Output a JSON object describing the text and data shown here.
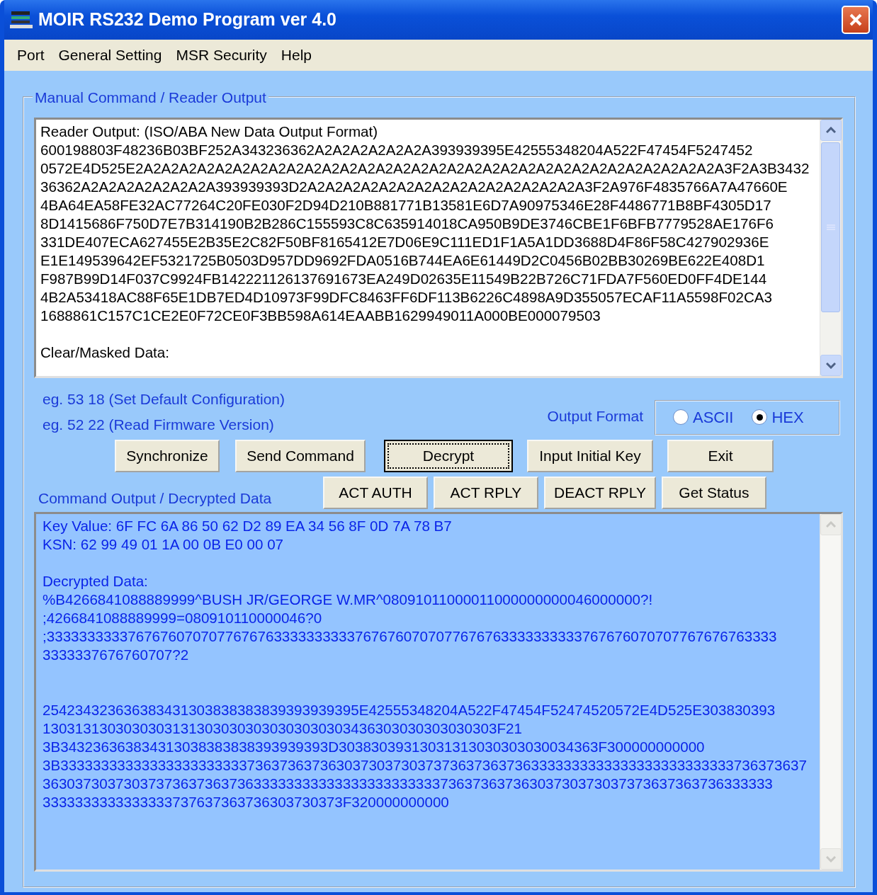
{
  "window": {
    "title": "MOIR RS232 Demo Program ver 4.0"
  },
  "menu": [
    "Port",
    "General Setting",
    "MSR Security",
    "Help"
  ],
  "reader_group": {
    "legend": "Manual Command / Reader Output"
  },
  "reader_output": {
    "lines": [
      "Reader Output: (ISO/ABA New Data Output Format)",
      "600198803F48236B03BF252A343236362A2A2A2A2A2A2A393939395E42555348204A522F47454F5247452",
      "0572E4D525E2A2A2A2A2A2A2A2A2A2A2A2A2A2A2A2A2A2A2A2A2A2A2A2A2A2A2A2A2A2A2A2A2A3F2A3B3432",
      "36362A2A2A2A2A2A2A2A393939393D2A2A2A2A2A2A2A2A2A2A2A2A2A2A2A2A3F2A976F4835766A7A47660E",
      "4BA64EA58FE32AC77264C20FE030F2D94D210B881771B13581E6D7A90975346E28F4486771B8BF4305D17",
      "8D1415686F750D7E7B314190B2B286C155593C8C635914018CA950B9DE3746CBE1F6BFB7779528AE176F6",
      "331DE407ECA627455E2B35E2C82F50BF8165412E7D06E9C111ED1F1A5A1DD3688D4F86F58C427902936E",
      "E1E149539642EF5321725B0503D957DD9692FDA0516B744EA6E61449D2C0456B02BB30269BE622E408D1",
      "F987B99D14F037C9924FB142221126137691673EA249D02635E11549B22B726C71FDA7F560ED0FF4DE144",
      "4B2A53418AC88F65E1DB7ED4D10973F99DFC8463FF6DF113B6226C4898A9D355057ECAF11A5598F02CA3",
      "1688861C157C1CE2E0F72CE0F3BB598A614EAABB1629949011A000BE000079503"
    ],
    "masked_label": "Clear/Masked Data:"
  },
  "examples": [
    "eg. 53 18 (Set Default Configuration)",
    "eg. 52 22 (Read Firmware Version)"
  ],
  "output_format": {
    "label": "Output Format",
    "options": [
      {
        "label": "ASCII",
        "selected": false
      },
      {
        "label": "HEX",
        "selected": true
      }
    ]
  },
  "buttons_row1": [
    {
      "label": "Synchronize",
      "focused": false
    },
    {
      "label": "Send Command",
      "focused": false
    },
    {
      "label": "Decrypt",
      "focused": true
    },
    {
      "label": "Input Initial Key",
      "focused": false
    },
    {
      "label": "Exit",
      "focused": false
    }
  ],
  "command_label": "Command Output / Decrypted Data",
  "buttons_row2": [
    {
      "label": "ACT AUTH",
      "focused": false
    },
    {
      "label": "ACT RPLY",
      "focused": false
    },
    {
      "label": "DEACT RPLY",
      "focused": false
    },
    {
      "label": "Get Status",
      "focused": false
    }
  ],
  "command_output": {
    "blocks": [
      [
        "Key Value: 6F FC 6A 86 50 62 D2 89 EA 34 56 8F 0D 7A 78 B7",
        "KSN: 62 99 49 01 1A 00 0B E0 00 07"
      ],
      [
        "Decrypted Data:",
        "%B4266841088889999^BUSH JR/GEORGE W.MR^08091011000011000000000046000000?!",
        ";4266841088889999=080910110000046?0",
        ";333333333376767607070776767633333333337676760707077676763333333333767676070707767676763333",
        "3333337676760707?2"
      ],
      [
        "254234323636383431303838383839393939395E42555348204A522F47454F52474520572E4D525E303830393",
        "13031313030303031313030303030303030303436303030303030303F21",
        "3B343236363834313038383838393939393D30383039313031313030303030034363F300000000000",
        "3B33333333333333333333333736373637363037303730373736373637363333333333333333333333333736373637",
        "363037303730373736373637363333333333333333333333373637363736303730373037373637363736333333",
        "3333333333333333737637363736303730373F320000000000"
      ]
    ]
  }
}
